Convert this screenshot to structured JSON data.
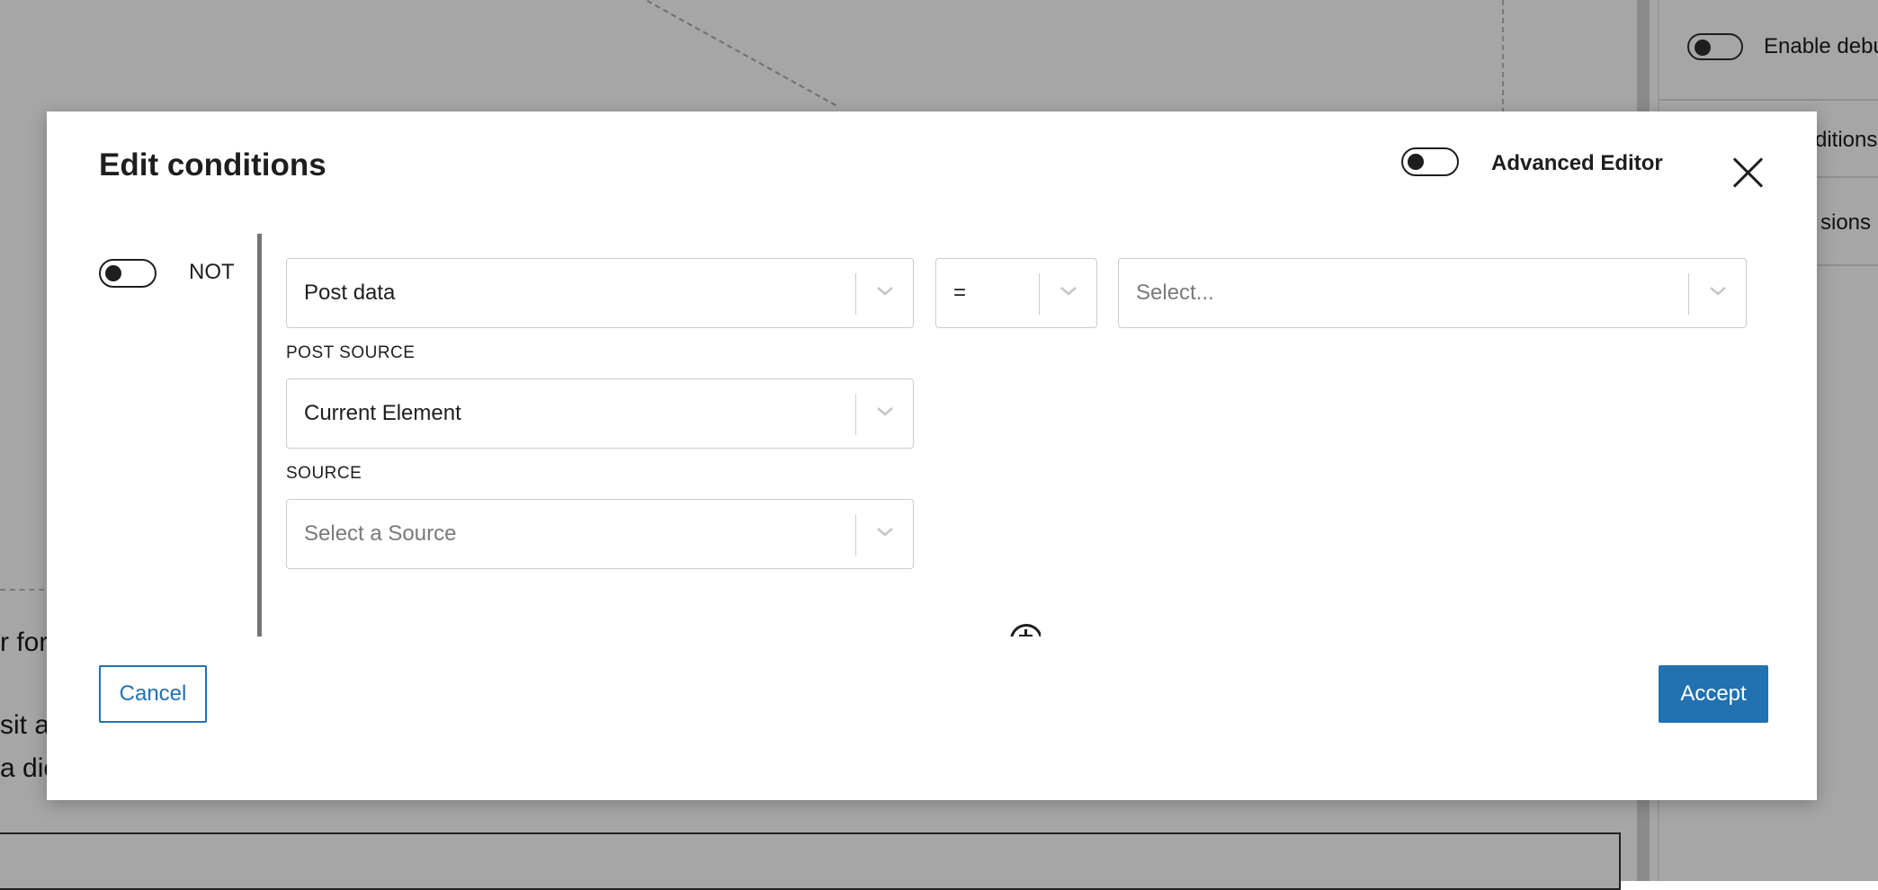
{
  "background": {
    "texts": [
      "r for",
      "sit ar",
      "a dic"
    ],
    "sidebar": {
      "debug_label": "Enable debu",
      "item_conditions": "ditions",
      "item_sions": "sions"
    }
  },
  "modal": {
    "title": "Edit conditions",
    "advanced_editor_label": "Advanced Editor",
    "advanced_editor_enabled": false,
    "close_icon": "close-icon",
    "not_label": "NOT",
    "not_enabled": false,
    "condition": {
      "subject": "Post data",
      "operator": "=",
      "value_placeholder": "Select...",
      "post_source_label": "POST SOURCE",
      "post_source": "Current Element",
      "source_label": "SOURCE",
      "source_placeholder": "Select a Source"
    },
    "add_icon": "plus-circle-icon",
    "cancel_label": "Cancel",
    "accept_label": "Accept",
    "colors": {
      "accent": "#2271b1",
      "text": "#1e1e1e",
      "overlay": "#a6a6a6"
    }
  }
}
